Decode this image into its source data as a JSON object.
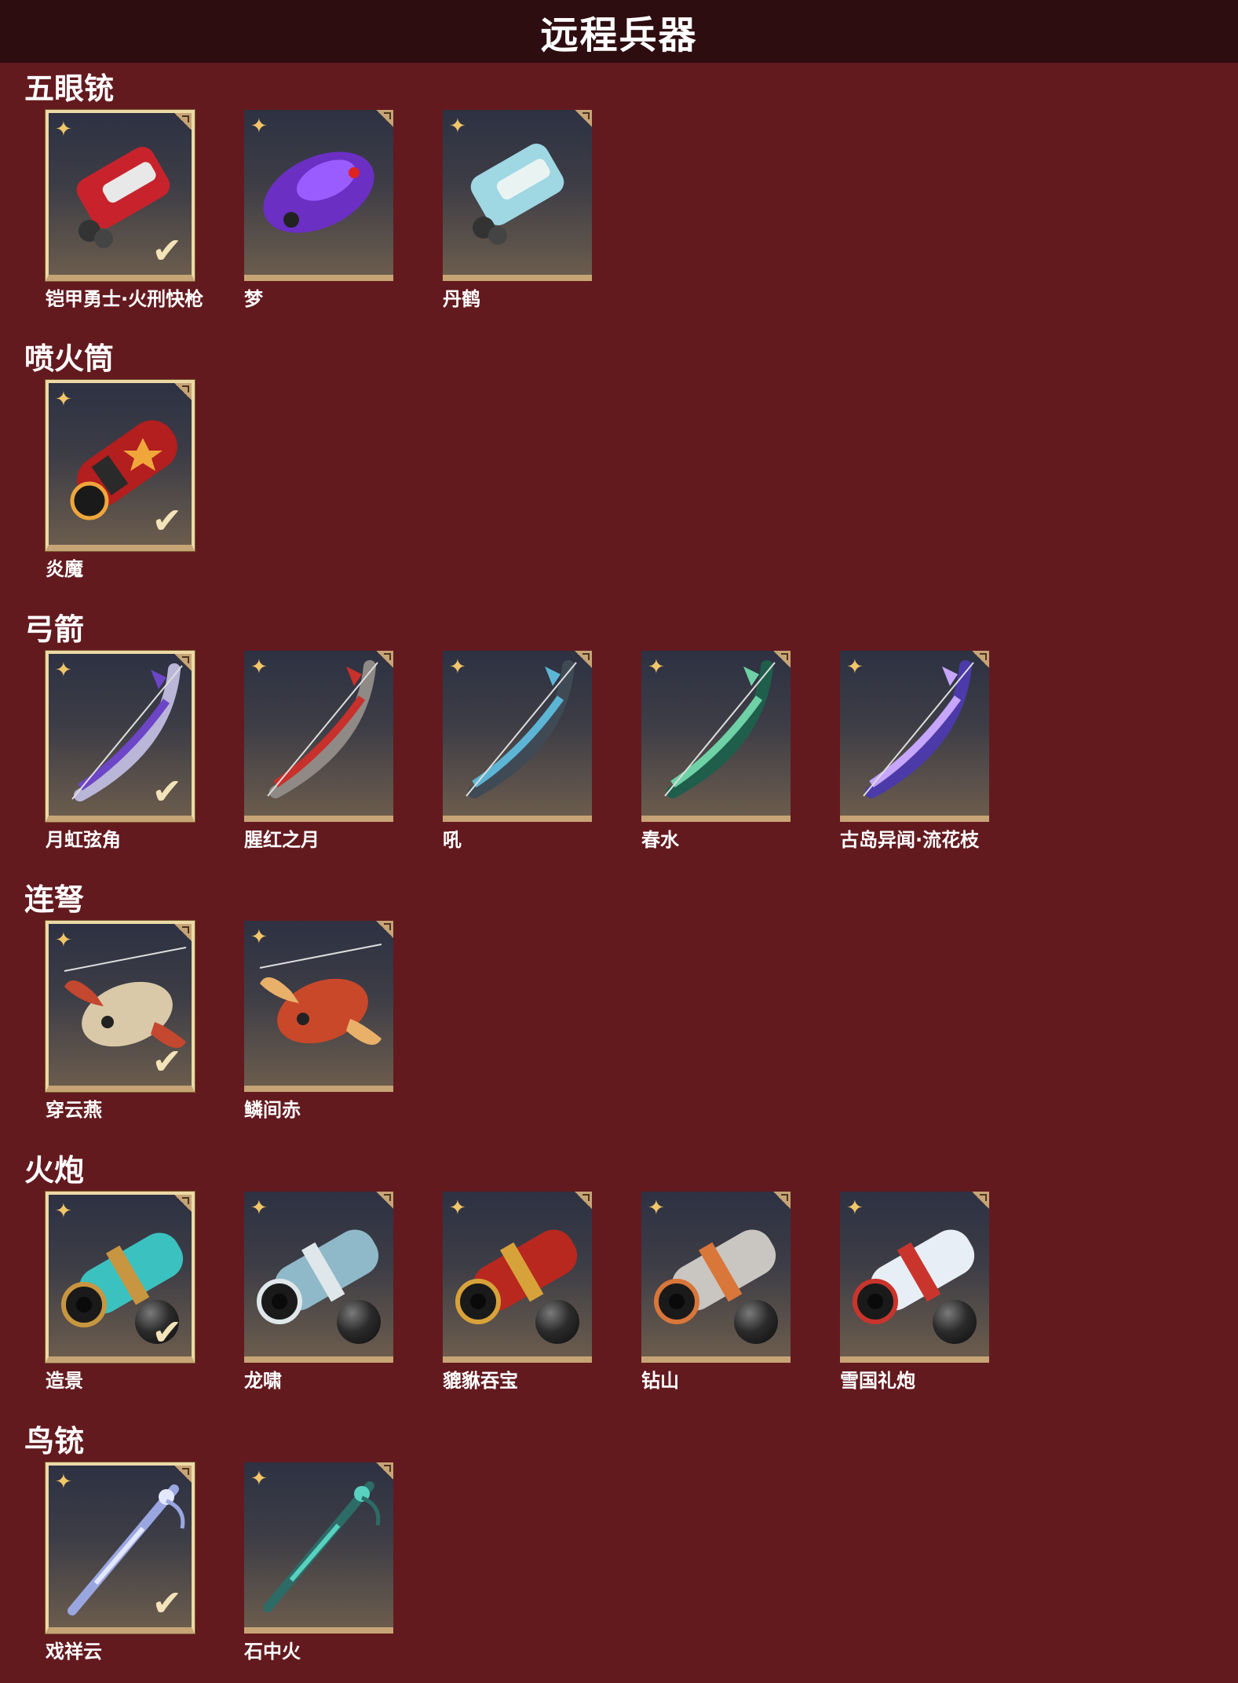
{
  "header": {
    "title": "远程兵器"
  },
  "sections": [
    {
      "title": "五眼铳",
      "items": [
        {
          "label": "铠甲勇士·火刑快枪",
          "selected": true,
          "ammo": false,
          "color": "#c8232c",
          "accent": "#e8e8e8",
          "shape": "block"
        },
        {
          "label": "梦",
          "selected": false,
          "ammo": false,
          "color": "#6b2fc4",
          "accent": "#9b5cff",
          "shape": "fur"
        },
        {
          "label": "丹鹤",
          "selected": false,
          "ammo": false,
          "color": "#9fd7e3",
          "accent": "#e9f4f2",
          "shape": "block"
        }
      ]
    },
    {
      "title": "喷火筒",
      "items": [
        {
          "label": "炎魔",
          "selected": true,
          "ammo": false,
          "color": "#b31e1e",
          "accent": "#f0a63b",
          "shape": "tube"
        }
      ]
    },
    {
      "title": "弓箭",
      "items": [
        {
          "label": "月虹弦角",
          "selected": true,
          "ammo": false,
          "color": "#b9b6d8",
          "accent": "#6d45c7",
          "shape": "bow"
        },
        {
          "label": "腥红之月",
          "selected": false,
          "ammo": false,
          "color": "#8f8a86",
          "accent": "#c8302c",
          "shape": "bow"
        },
        {
          "label": "吼",
          "selected": false,
          "ammo": false,
          "color": "#3f4a55",
          "accent": "#5db5d6",
          "shape": "bow"
        },
        {
          "label": "春水",
          "selected": false,
          "ammo": false,
          "color": "#1f5e4b",
          "accent": "#6fd1a6",
          "shape": "bow"
        },
        {
          "label": "古岛异闻·流花枝",
          "selected": false,
          "ammo": false,
          "color": "#4b3aa8",
          "accent": "#c6a6ff",
          "shape": "bow"
        }
      ]
    },
    {
      "title": "连弩",
      "items": [
        {
          "label": "穿云燕",
          "selected": true,
          "ammo": false,
          "color": "#d9c9a8",
          "accent": "#c4472f",
          "shape": "bird"
        },
        {
          "label": "鳞间赤",
          "selected": false,
          "ammo": false,
          "color": "#c9482a",
          "accent": "#e9b06a",
          "shape": "bird"
        }
      ]
    },
    {
      "title": "火炮",
      "items": [
        {
          "label": "造景",
          "selected": true,
          "ammo": true,
          "color": "#3bc1bf",
          "accent": "#c89640",
          "shape": "cannon"
        },
        {
          "label": "龙啸",
          "selected": false,
          "ammo": true,
          "color": "#8fb9c8",
          "accent": "#dfe7ea",
          "shape": "cannon"
        },
        {
          "label": "貔貅吞宝",
          "selected": false,
          "ammo": true,
          "color": "#b8281e",
          "accent": "#d8a23a",
          "shape": "cannon"
        },
        {
          "label": "钻山",
          "selected": false,
          "ammo": true,
          "color": "#c9c6c2",
          "accent": "#d9763a",
          "shape": "cannon"
        },
        {
          "label": "雪国礼炮",
          "selected": false,
          "ammo": true,
          "color": "#e8eef5",
          "accent": "#c9352c",
          "shape": "cannon"
        }
      ]
    },
    {
      "title": "鸟铳",
      "items": [
        {
          "label": "戏祥云",
          "selected": true,
          "ammo": false,
          "color": "#9aa6e0",
          "accent": "#e3e8ff",
          "shape": "rifle"
        },
        {
          "label": "石中火",
          "selected": false,
          "ammo": false,
          "color": "#2c6b66",
          "accent": "#58d1c0",
          "shape": "rifle"
        }
      ]
    }
  ],
  "icons": {
    "rarity": "star-icon",
    "equipped": "checkmark-icon",
    "ammo": "cannonball-icon"
  }
}
